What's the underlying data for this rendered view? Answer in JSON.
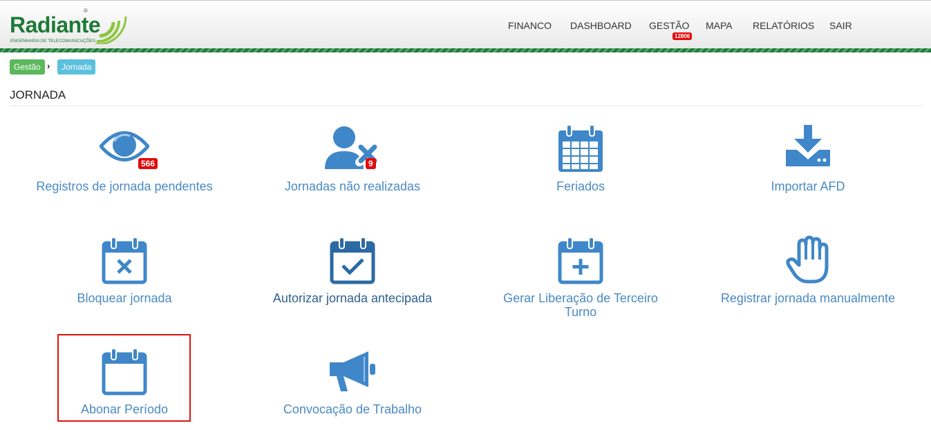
{
  "brand": {
    "name": "Radiante",
    "tagline": "ENGENHARIA DE TELECOMUNICAÇÕES",
    "registered": "®",
    "brand_green": "#1d7a36",
    "accent_lime": "#8cc63f"
  },
  "nav": {
    "items": [
      {
        "label": "FINANCO"
      },
      {
        "label": "DASHBOARD"
      },
      {
        "label": "GESTÃO",
        "badge": "12806"
      },
      {
        "label": "MAPA"
      },
      {
        "label": "RELATÓRIOS"
      },
      {
        "label": "SAIR"
      }
    ]
  },
  "breadcrumb": {
    "items": [
      "Gestão",
      "Jornada"
    ],
    "separator": "›"
  },
  "page": {
    "title": "JORNADA"
  },
  "tiles": [
    {
      "label": "Registros de jornada pendentes",
      "icon": "eye-icon",
      "badge": "566"
    },
    {
      "label": "Jornadas não realizadas",
      "icon": "user-remove-icon",
      "badge": "9"
    },
    {
      "label": "Feriados",
      "icon": "calendar-grid-icon"
    },
    {
      "label": "Importar AFD",
      "icon": "download-drive-icon"
    },
    {
      "label": "Bloquear jornada",
      "icon": "calendar-times-icon"
    },
    {
      "label": "Autorizar jornada antecipada",
      "icon": "calendar-check-icon"
    },
    {
      "label": "Gerar Liberação de Terceiro Turno",
      "icon": "calendar-plus-icon"
    },
    {
      "label": "Registrar jornada manualmente",
      "icon": "hand-icon"
    },
    {
      "label": "Abonar Período",
      "icon": "calendar-blank-icon",
      "highlighted": true
    },
    {
      "label": "Convocação de Trabalho",
      "icon": "megaphone-icon"
    }
  ],
  "colors": {
    "icon_blue": "#3f87c9",
    "icon_dark_blue": "#2c6aa3",
    "label_blue": "#4a8ac4",
    "badge_red": "#e20b0b",
    "highlight_red": "#e01010",
    "crumb_green": "#5cb85c",
    "crumb_cyan": "#5bc0de"
  }
}
